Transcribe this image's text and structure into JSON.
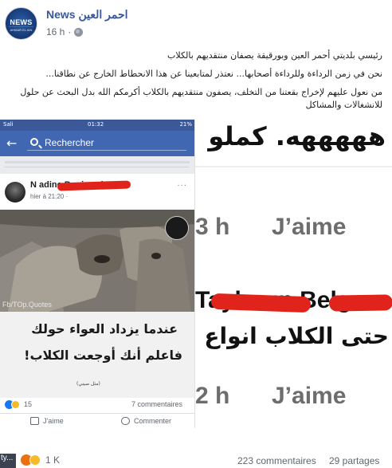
{
  "post": {
    "page_name": "News احمر العين",
    "timestamp": "16 h",
    "privacy_icon": "globe-icon",
    "avatar": {
      "word": "NEWS",
      "sub": "AHMAR EL AIN"
    },
    "text_line1": "رئيسي بلديتي أحمر العين وبورقيقة يصفان منتقديهم بالكلاب",
    "text_line2": "نحن في زمن الرداءة وللرداءة أصحابها... نعتذر لمتابعينا عن هذا الانحطاط الخارج عن نطاقنا...",
    "text_line3": "من نعول عليهم لإخراج بقعتنا من التخلف، يصفون منتقديهم بالكلاب أكرمكم الله بدل البحث عن حلول للانشغالات والمشاكل"
  },
  "screenshot_left": {
    "status_left": "Sali",
    "status_time": "01:32",
    "status_right": "21%",
    "search_placeholder": "Rechercher",
    "inner_name": "N     adine Bouizen l",
    "inner_time": "hier à 21:20 · ",
    "inner_more": "···",
    "watermark": "Fb/TOp.Quotes",
    "quote_line1": "عندما يزداد العواء حولك",
    "quote_line2": "فاعلم أنك أوجعت الكلاب!",
    "quote_attrib": "(مثل صيني)",
    "react_count": "15",
    "comment_count": "7 commentaires",
    "like_label": "J'aime",
    "comment_label": "Commenter",
    "colors": {
      "facebook_blue": "#3b5998",
      "redaction": "#e0241b"
    }
  },
  "screenshot_right": {
    "laugh_text": "هههههه. كملو",
    "time1": "3 h",
    "like1": "J’aime",
    "name": "Tayboun Belges",
    "comment_text": "حتى الكلاب انواع",
    "time2": "2 h",
    "like2": "J’aime"
  },
  "footer": {
    "tag_text": "ty...",
    "reactions": [
      "angry",
      "haha"
    ],
    "reaction_count": "1 K",
    "comment_count": "223 commentaires",
    "share_count": "29 partages"
  }
}
